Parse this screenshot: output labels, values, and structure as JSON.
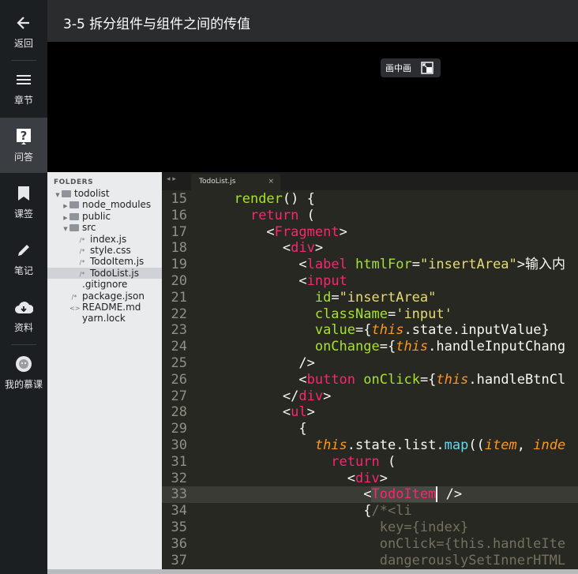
{
  "sidebar": {
    "items": [
      {
        "label": "返回",
        "icon": "back-arrow-icon"
      },
      {
        "label": "章节",
        "icon": "menu-list-icon"
      },
      {
        "label": "问答",
        "icon": "question-icon",
        "active": true
      },
      {
        "label": "课签",
        "icon": "bookmark-icon"
      },
      {
        "label": "笔记",
        "icon": "pencil-icon"
      },
      {
        "label": "资料",
        "icon": "cloud-download-icon"
      },
      {
        "label": "我的慕课",
        "icon": "avatar-icon"
      }
    ]
  },
  "header": {
    "title": "3-5 拆分组件与组件之间的传值"
  },
  "video": {
    "pip_label": "画中画"
  },
  "file_panel": {
    "header": "FOLDERS",
    "tree": [
      {
        "name": "todolist",
        "type": "folder",
        "open": true,
        "depth": 0
      },
      {
        "name": "node_modules",
        "type": "folder",
        "open": false,
        "depth": 1
      },
      {
        "name": "public",
        "type": "folder",
        "open": false,
        "depth": 1
      },
      {
        "name": "src",
        "type": "folder",
        "open": true,
        "depth": 1
      },
      {
        "name": "index.js",
        "type": "file",
        "icon": "/*",
        "depth": 2
      },
      {
        "name": "style.css",
        "type": "file",
        "icon": "/*",
        "depth": 2
      },
      {
        "name": "TodoItem.js",
        "type": "file",
        "icon": "/*",
        "depth": 2
      },
      {
        "name": "TodoList.js",
        "type": "file",
        "icon": "/*",
        "depth": 2,
        "selected": true
      },
      {
        "name": ".gitignore",
        "type": "file",
        "icon": "",
        "depth": 1
      },
      {
        "name": "package.json",
        "type": "file",
        "icon": "/*",
        "depth": 1
      },
      {
        "name": "README.md",
        "type": "file",
        "icon": "<>",
        "depth": 1
      },
      {
        "name": "yarn.lock",
        "type": "file",
        "icon": "",
        "depth": 1
      }
    ]
  },
  "editor": {
    "tab": {
      "label": "TodoList.js",
      "nav": "◂ ▸",
      "close": "×"
    },
    "colors": {
      "bg": "#272822",
      "keyword": "#f92672",
      "attr": "#a6e22e",
      "string": "#e6db74",
      "plain": "#f8f8f2",
      "italic": "#fd971f",
      "func": "#66d9ef",
      "comment": "#75715e"
    },
    "current_line": 33,
    "lines": [
      {
        "n": "15",
        "t": [
          [
            "  ",
            ""
          ],
          [
            "render",
            "attr"
          ],
          [
            "() {",
            "plain"
          ]
        ]
      },
      {
        "n": "16",
        "t": [
          [
            "    ",
            ""
          ],
          [
            "return",
            "keyword"
          ],
          [
            " (",
            "plain"
          ]
        ]
      },
      {
        "n": "17",
        "t": [
          [
            "      ",
            ""
          ],
          [
            "<",
            "plain"
          ],
          [
            "Fragment",
            "keyword"
          ],
          [
            ">",
            "plain"
          ]
        ]
      },
      {
        "n": "18",
        "t": [
          [
            "        ",
            ""
          ],
          [
            "<",
            "plain"
          ],
          [
            "div",
            "keyword"
          ],
          [
            ">",
            "plain"
          ]
        ]
      },
      {
        "n": "19",
        "t": [
          [
            "          ",
            ""
          ],
          [
            "<",
            "plain"
          ],
          [
            "label",
            "keyword"
          ],
          [
            " ",
            ""
          ],
          [
            "htmlFor",
            "attr"
          ],
          [
            "=",
            "plain"
          ],
          [
            "\"insertArea\"",
            "string"
          ],
          [
            ">输入内",
            "plain"
          ]
        ]
      },
      {
        "n": "20",
        "t": [
          [
            "          ",
            ""
          ],
          [
            "<",
            "plain"
          ],
          [
            "input",
            "keyword"
          ]
        ]
      },
      {
        "n": "21",
        "t": [
          [
            "            ",
            ""
          ],
          [
            "id",
            "attr"
          ],
          [
            "=",
            "plain"
          ],
          [
            "\"insertArea\"",
            "string"
          ]
        ]
      },
      {
        "n": "22",
        "t": [
          [
            "            ",
            ""
          ],
          [
            "className",
            "attr"
          ],
          [
            "=",
            "plain"
          ],
          [
            "'input'",
            "string"
          ]
        ]
      },
      {
        "n": "23",
        "t": [
          [
            "            ",
            ""
          ],
          [
            "value",
            "attr"
          ],
          [
            "={",
            "plain"
          ],
          [
            "this",
            "italic"
          ],
          [
            ".state.inputValue}",
            "plain"
          ]
        ]
      },
      {
        "n": "24",
        "t": [
          [
            "            ",
            ""
          ],
          [
            "onChange",
            "attr"
          ],
          [
            "={",
            "plain"
          ],
          [
            "this",
            "italic"
          ],
          [
            ".handleInputChang",
            "plain"
          ]
        ]
      },
      {
        "n": "25",
        "t": [
          [
            "          ",
            ""
          ],
          [
            "/>",
            "plain"
          ]
        ]
      },
      {
        "n": "26",
        "t": [
          [
            "          ",
            ""
          ],
          [
            "<",
            "plain"
          ],
          [
            "button",
            "keyword"
          ],
          [
            " ",
            ""
          ],
          [
            "onClick",
            "attr"
          ],
          [
            "={",
            "plain"
          ],
          [
            "this",
            "italic"
          ],
          [
            ".handleBtnCl",
            "plain"
          ]
        ]
      },
      {
        "n": "27",
        "t": [
          [
            "        ",
            ""
          ],
          [
            "</",
            "plain"
          ],
          [
            "div",
            "keyword"
          ],
          [
            ">",
            "plain"
          ]
        ]
      },
      {
        "n": "28",
        "t": [
          [
            "        ",
            ""
          ],
          [
            "<",
            "plain"
          ],
          [
            "ul",
            "keyword"
          ],
          [
            ">",
            "plain"
          ]
        ]
      },
      {
        "n": "29",
        "t": [
          [
            "          ",
            ""
          ],
          [
            "{",
            "plain"
          ]
        ]
      },
      {
        "n": "30",
        "t": [
          [
            "            ",
            ""
          ],
          [
            "this",
            "italic"
          ],
          [
            ".state.list.",
            "plain"
          ],
          [
            "map",
            "func"
          ],
          [
            "((",
            "plain"
          ],
          [
            "item",
            "italic"
          ],
          [
            ", ",
            "plain"
          ],
          [
            "inde",
            "italic"
          ]
        ]
      },
      {
        "n": "31",
        "t": [
          [
            "              ",
            ""
          ],
          [
            "return",
            "keyword"
          ],
          [
            " (",
            "plain"
          ]
        ]
      },
      {
        "n": "32",
        "t": [
          [
            "                ",
            ""
          ],
          [
            "<",
            "plain"
          ],
          [
            "div",
            "keyword"
          ],
          [
            ">",
            "plain"
          ]
        ]
      },
      {
        "n": "33",
        "t": [
          [
            "                  ",
            ""
          ],
          [
            "<",
            "plain"
          ],
          [
            "TodoItem",
            "keyword"
          ],
          [
            " />",
            "plain"
          ]
        ]
      },
      {
        "n": "34",
        "t": [
          [
            "                  ",
            ""
          ],
          [
            "{",
            "plain"
          ],
          [
            "/*<li",
            "comment"
          ]
        ]
      },
      {
        "n": "35",
        "t": [
          [
            "                    ",
            ""
          ],
          [
            "key={index}",
            "comment"
          ]
        ]
      },
      {
        "n": "36",
        "t": [
          [
            "                    ",
            ""
          ],
          [
            "onClick={this.handleIte",
            "comment"
          ]
        ]
      },
      {
        "n": "37",
        "t": [
          [
            "                    ",
            ""
          ],
          [
            "dangerouslySetInnerHTML",
            "comment"
          ]
        ]
      }
    ]
  }
}
